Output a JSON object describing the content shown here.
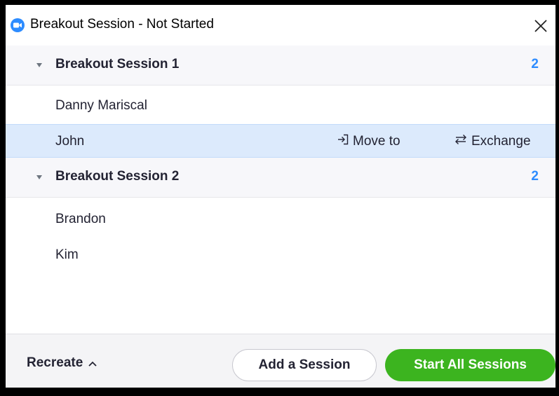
{
  "window": {
    "title": "Breakout Session - Not Started",
    "logo_icon": "zoom-camera-icon",
    "close_icon": "close-x-icon"
  },
  "sessions": [
    {
      "name": "Breakout Session 1",
      "count": "2",
      "participants": [
        {
          "name": "Danny Mariscal"
        },
        {
          "name": "John",
          "selected": true
        }
      ]
    },
    {
      "name": "Breakout Session 2",
      "count": "2",
      "participants": [
        {
          "name": "Brandon"
        },
        {
          "name": "Kim"
        }
      ]
    }
  ],
  "row_actions": {
    "move_label": "Move to",
    "move_icon": "move-to-icon",
    "exchange_label": "Exchange",
    "exchange_icon": "exchange-arrows-icon"
  },
  "footer": {
    "recreate_label": "Recreate",
    "recreate_icon": "chevron-up-icon",
    "add_session_label": "Add a Session",
    "start_all_label": "Start All Sessions"
  },
  "colors": {
    "accent_blue": "#2d8cff",
    "start_green": "#3cb41f",
    "selected_row": "#dceafc"
  }
}
